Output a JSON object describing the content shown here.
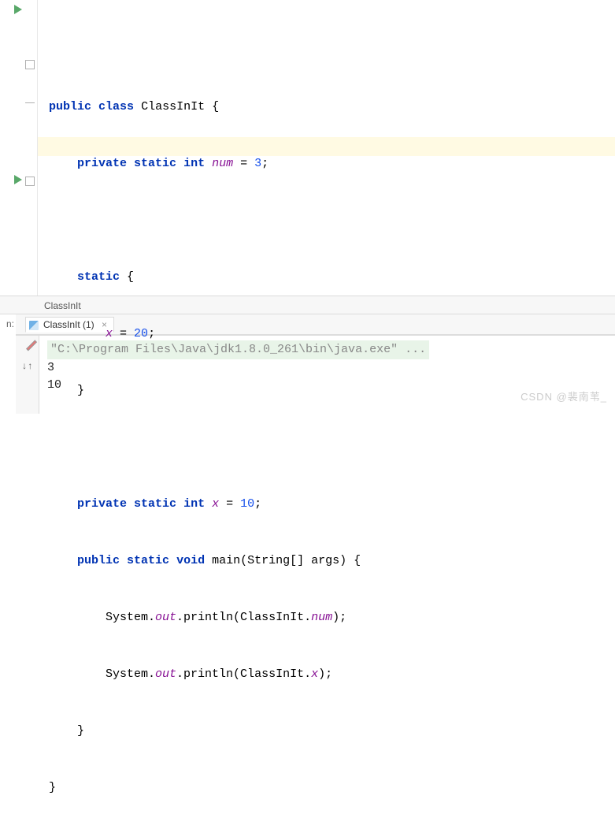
{
  "code": {
    "l1": "public class ClassInIt {",
    "l2": "    private static int num = 3;",
    "l3": "",
    "l4": "    static {",
    "l5": "        x = 20;",
    "l6": "    }",
    "l7": "",
    "l8": "    private static int x = 10;",
    "l9": "    public static void main(String[] args) {",
    "l10": "        System.out.println(ClassInIt.num);",
    "l11": "        System.out.println(ClassInIt.x);",
    "l12": "    }",
    "l13": "}"
  },
  "tokens": {
    "kw_public": "public",
    "kw_class": "class",
    "cls_name": "ClassInIt",
    "kw_private": "private",
    "kw_static": "static",
    "kw_int": "int",
    "kw_void": "void",
    "field_num": "num",
    "eq": " = ",
    "val_3": "3",
    "semicolon": ";",
    "field_x": "x",
    "val_20": "20",
    "val_10": "10",
    "method_main": "main",
    "args_sig": "(String[] args) {",
    "sys": "System.",
    "out": "out",
    "println_open": ".println(ClassInIt.",
    "paren_close": ");",
    "brace_open": " {",
    "brace_close": "}",
    "ind1": "    ",
    "ind2": "        "
  },
  "breadcrumb": "ClassInIt",
  "run": {
    "label": "n:",
    "tab_name": "ClassInIt (1)",
    "close": "×",
    "cmd": "\"C:\\Program Files\\Java\\jdk1.8.0_261\\bin\\java.exe\" ...",
    "out1": "3",
    "out2": "10"
  },
  "watermark": "CSDN @裴南苇_"
}
